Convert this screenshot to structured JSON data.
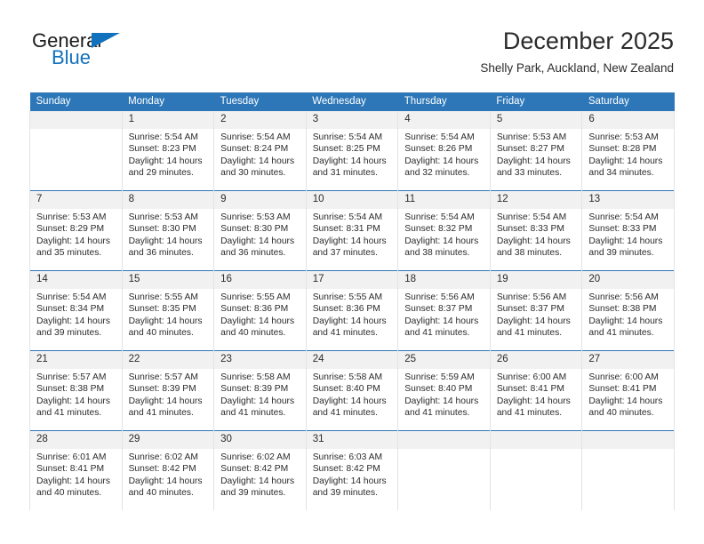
{
  "brand": {
    "name_top": "General",
    "name_bottom": "Blue",
    "accent_color": "#1271bd"
  },
  "header": {
    "title": "December 2025",
    "subtitle": "Shelly Park, Auckland, New Zealand"
  },
  "calendar": {
    "header_bg": "#2d77b8",
    "daynum_bg": "#f1f1f1",
    "weekday_headers": [
      "Sunday",
      "Monday",
      "Tuesday",
      "Wednesday",
      "Thursday",
      "Friday",
      "Saturday"
    ],
    "weeks": [
      [
        {
          "day": "",
          "sunrise": "",
          "sunset": "",
          "daylight1": "",
          "daylight2": "",
          "empty": true
        },
        {
          "day": "1",
          "sunrise": "Sunrise: 5:54 AM",
          "sunset": "Sunset: 8:23 PM",
          "daylight1": "Daylight: 14 hours",
          "daylight2": "and 29 minutes."
        },
        {
          "day": "2",
          "sunrise": "Sunrise: 5:54 AM",
          "sunset": "Sunset: 8:24 PM",
          "daylight1": "Daylight: 14 hours",
          "daylight2": "and 30 minutes."
        },
        {
          "day": "3",
          "sunrise": "Sunrise: 5:54 AM",
          "sunset": "Sunset: 8:25 PM",
          "daylight1": "Daylight: 14 hours",
          "daylight2": "and 31 minutes."
        },
        {
          "day": "4",
          "sunrise": "Sunrise: 5:54 AM",
          "sunset": "Sunset: 8:26 PM",
          "daylight1": "Daylight: 14 hours",
          "daylight2": "and 32 minutes."
        },
        {
          "day": "5",
          "sunrise": "Sunrise: 5:53 AM",
          "sunset": "Sunset: 8:27 PM",
          "daylight1": "Daylight: 14 hours",
          "daylight2": "and 33 minutes."
        },
        {
          "day": "6",
          "sunrise": "Sunrise: 5:53 AM",
          "sunset": "Sunset: 8:28 PM",
          "daylight1": "Daylight: 14 hours",
          "daylight2": "and 34 minutes."
        }
      ],
      [
        {
          "day": "7",
          "sunrise": "Sunrise: 5:53 AM",
          "sunset": "Sunset: 8:29 PM",
          "daylight1": "Daylight: 14 hours",
          "daylight2": "and 35 minutes."
        },
        {
          "day": "8",
          "sunrise": "Sunrise: 5:53 AM",
          "sunset": "Sunset: 8:30 PM",
          "daylight1": "Daylight: 14 hours",
          "daylight2": "and 36 minutes."
        },
        {
          "day": "9",
          "sunrise": "Sunrise: 5:53 AM",
          "sunset": "Sunset: 8:30 PM",
          "daylight1": "Daylight: 14 hours",
          "daylight2": "and 36 minutes."
        },
        {
          "day": "10",
          "sunrise": "Sunrise: 5:54 AM",
          "sunset": "Sunset: 8:31 PM",
          "daylight1": "Daylight: 14 hours",
          "daylight2": "and 37 minutes."
        },
        {
          "day": "11",
          "sunrise": "Sunrise: 5:54 AM",
          "sunset": "Sunset: 8:32 PM",
          "daylight1": "Daylight: 14 hours",
          "daylight2": "and 38 minutes."
        },
        {
          "day": "12",
          "sunrise": "Sunrise: 5:54 AM",
          "sunset": "Sunset: 8:33 PM",
          "daylight1": "Daylight: 14 hours",
          "daylight2": "and 38 minutes."
        },
        {
          "day": "13",
          "sunrise": "Sunrise: 5:54 AM",
          "sunset": "Sunset: 8:33 PM",
          "daylight1": "Daylight: 14 hours",
          "daylight2": "and 39 minutes."
        }
      ],
      [
        {
          "day": "14",
          "sunrise": "Sunrise: 5:54 AM",
          "sunset": "Sunset: 8:34 PM",
          "daylight1": "Daylight: 14 hours",
          "daylight2": "and 39 minutes."
        },
        {
          "day": "15",
          "sunrise": "Sunrise: 5:55 AM",
          "sunset": "Sunset: 8:35 PM",
          "daylight1": "Daylight: 14 hours",
          "daylight2": "and 40 minutes."
        },
        {
          "day": "16",
          "sunrise": "Sunrise: 5:55 AM",
          "sunset": "Sunset: 8:36 PM",
          "daylight1": "Daylight: 14 hours",
          "daylight2": "and 40 minutes."
        },
        {
          "day": "17",
          "sunrise": "Sunrise: 5:55 AM",
          "sunset": "Sunset: 8:36 PM",
          "daylight1": "Daylight: 14 hours",
          "daylight2": "and 41 minutes."
        },
        {
          "day": "18",
          "sunrise": "Sunrise: 5:56 AM",
          "sunset": "Sunset: 8:37 PM",
          "daylight1": "Daylight: 14 hours",
          "daylight2": "and 41 minutes."
        },
        {
          "day": "19",
          "sunrise": "Sunrise: 5:56 AM",
          "sunset": "Sunset: 8:37 PM",
          "daylight1": "Daylight: 14 hours",
          "daylight2": "and 41 minutes."
        },
        {
          "day": "20",
          "sunrise": "Sunrise: 5:56 AM",
          "sunset": "Sunset: 8:38 PM",
          "daylight1": "Daylight: 14 hours",
          "daylight2": "and 41 minutes."
        }
      ],
      [
        {
          "day": "21",
          "sunrise": "Sunrise: 5:57 AM",
          "sunset": "Sunset: 8:38 PM",
          "daylight1": "Daylight: 14 hours",
          "daylight2": "and 41 minutes."
        },
        {
          "day": "22",
          "sunrise": "Sunrise: 5:57 AM",
          "sunset": "Sunset: 8:39 PM",
          "daylight1": "Daylight: 14 hours",
          "daylight2": "and 41 minutes."
        },
        {
          "day": "23",
          "sunrise": "Sunrise: 5:58 AM",
          "sunset": "Sunset: 8:39 PM",
          "daylight1": "Daylight: 14 hours",
          "daylight2": "and 41 minutes."
        },
        {
          "day": "24",
          "sunrise": "Sunrise: 5:58 AM",
          "sunset": "Sunset: 8:40 PM",
          "daylight1": "Daylight: 14 hours",
          "daylight2": "and 41 minutes."
        },
        {
          "day": "25",
          "sunrise": "Sunrise: 5:59 AM",
          "sunset": "Sunset: 8:40 PM",
          "daylight1": "Daylight: 14 hours",
          "daylight2": "and 41 minutes."
        },
        {
          "day": "26",
          "sunrise": "Sunrise: 6:00 AM",
          "sunset": "Sunset: 8:41 PM",
          "daylight1": "Daylight: 14 hours",
          "daylight2": "and 41 minutes."
        },
        {
          "day": "27",
          "sunrise": "Sunrise: 6:00 AM",
          "sunset": "Sunset: 8:41 PM",
          "daylight1": "Daylight: 14 hours",
          "daylight2": "and 40 minutes."
        }
      ],
      [
        {
          "day": "28",
          "sunrise": "Sunrise: 6:01 AM",
          "sunset": "Sunset: 8:41 PM",
          "daylight1": "Daylight: 14 hours",
          "daylight2": "and 40 minutes."
        },
        {
          "day": "29",
          "sunrise": "Sunrise: 6:02 AM",
          "sunset": "Sunset: 8:42 PM",
          "daylight1": "Daylight: 14 hours",
          "daylight2": "and 40 minutes."
        },
        {
          "day": "30",
          "sunrise": "Sunrise: 6:02 AM",
          "sunset": "Sunset: 8:42 PM",
          "daylight1": "Daylight: 14 hours",
          "daylight2": "and 39 minutes."
        },
        {
          "day": "31",
          "sunrise": "Sunrise: 6:03 AM",
          "sunset": "Sunset: 8:42 PM",
          "daylight1": "Daylight: 14 hours",
          "daylight2": "and 39 minutes."
        },
        {
          "day": "",
          "sunrise": "",
          "sunset": "",
          "daylight1": "",
          "daylight2": "",
          "blank": true
        },
        {
          "day": "",
          "sunrise": "",
          "sunset": "",
          "daylight1": "",
          "daylight2": "",
          "blank": true
        },
        {
          "day": "",
          "sunrise": "",
          "sunset": "",
          "daylight1": "",
          "daylight2": "",
          "blank": true
        }
      ]
    ]
  }
}
